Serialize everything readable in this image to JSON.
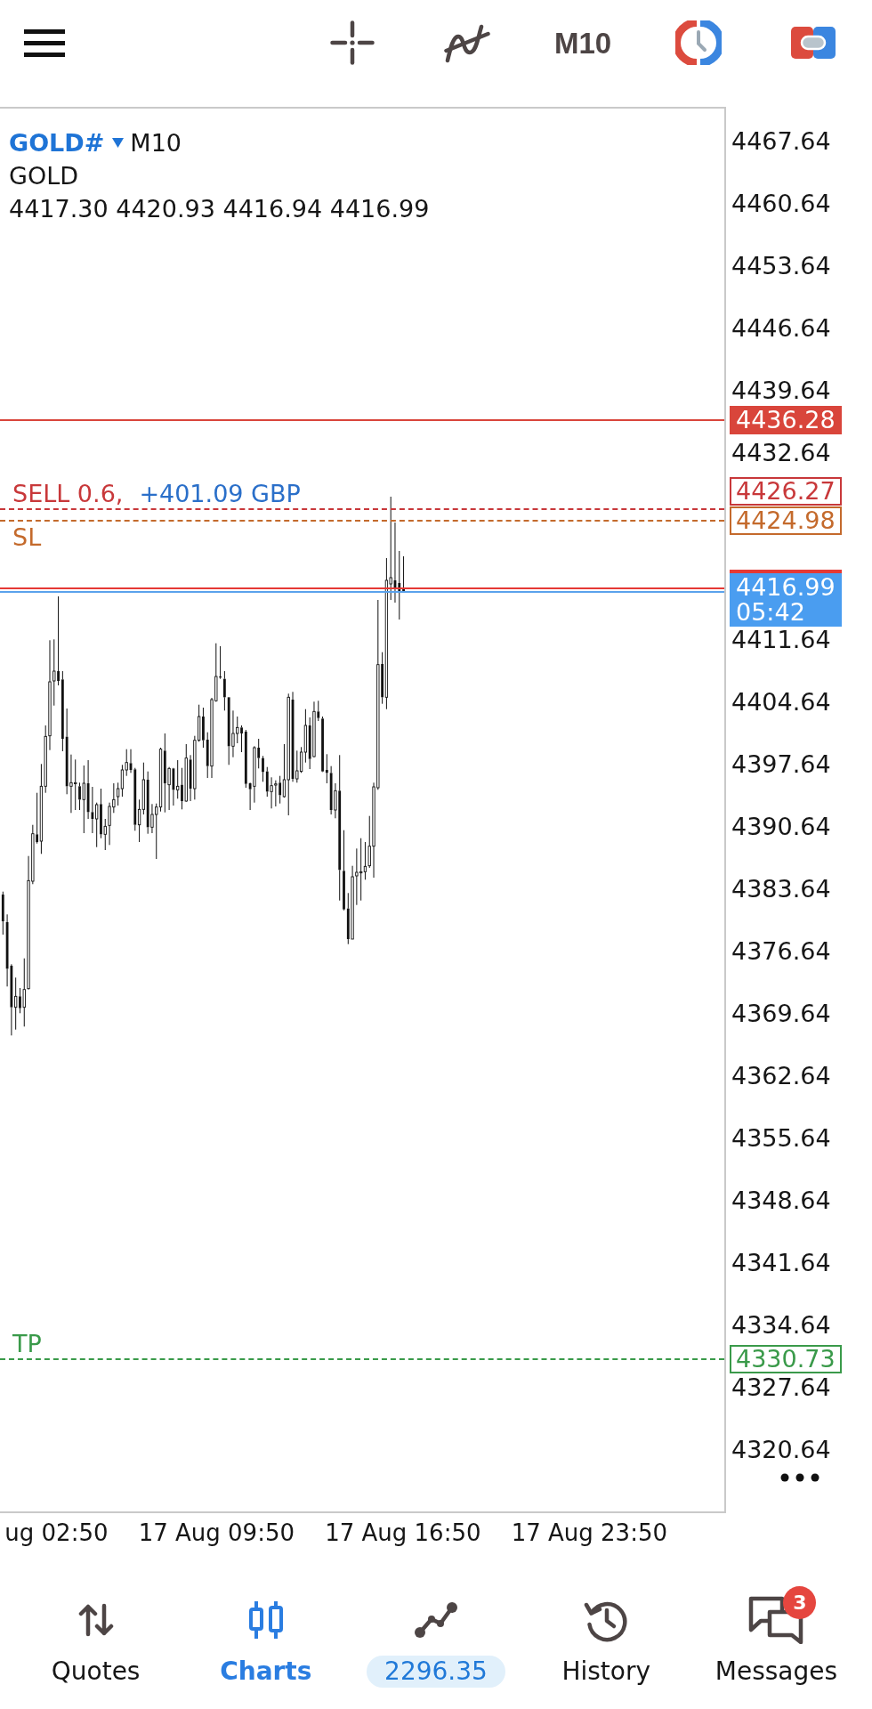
{
  "toolbar": {
    "timeframe": "M10"
  },
  "chart": {
    "symbol": "GOLD#",
    "period": "M10",
    "description": "GOLD",
    "ohlc": "4417.30 4420.93 4416.94 4416.99",
    "price_axis": [
      "4467.64",
      "4460.64",
      "4453.64",
      "4446.64",
      "4439.64",
      "4432.64",
      "4411.64",
      "4404.64",
      "4397.64",
      "4390.64",
      "4383.64",
      "4376.64",
      "4369.64",
      "4362.64",
      "4355.64",
      "4348.64",
      "4341.64",
      "4334.64",
      "4327.64",
      "4320.64"
    ],
    "price_lines": [
      {
        "kind": "solid",
        "label": "4436.28",
        "color": "#d9453b"
      },
      {
        "kind": "dashed",
        "label": "4426.27",
        "color": "#c8383a",
        "tag": "SELL 0.6,",
        "profit": "+401.09 GBP"
      },
      {
        "kind": "dashed",
        "label": "4424.98",
        "color": "#c46a2c",
        "tag": "SL"
      },
      {
        "kind": "dashed",
        "label": "4330.73",
        "color": "#3a9a4a",
        "tag": "TP"
      }
    ],
    "bid": {
      "label": "4416.99",
      "timer": "05:42"
    },
    "time_axis": [
      "ug 02:50",
      "17 Aug 09:50",
      "17 Aug 16:50",
      "17 Aug 23:50"
    ]
  },
  "nav": [
    {
      "kind": "tab",
      "label": "Quotes",
      "selected": false
    },
    {
      "kind": "tab",
      "label": "Charts",
      "selected": true
    },
    {
      "kind": "balance",
      "value": "2296.35",
      "selected": false
    },
    {
      "kind": "tab",
      "label": "History",
      "selected": false
    },
    {
      "kind": "tab",
      "label": "Messages",
      "selected": false,
      "badge": "3"
    }
  ]
}
